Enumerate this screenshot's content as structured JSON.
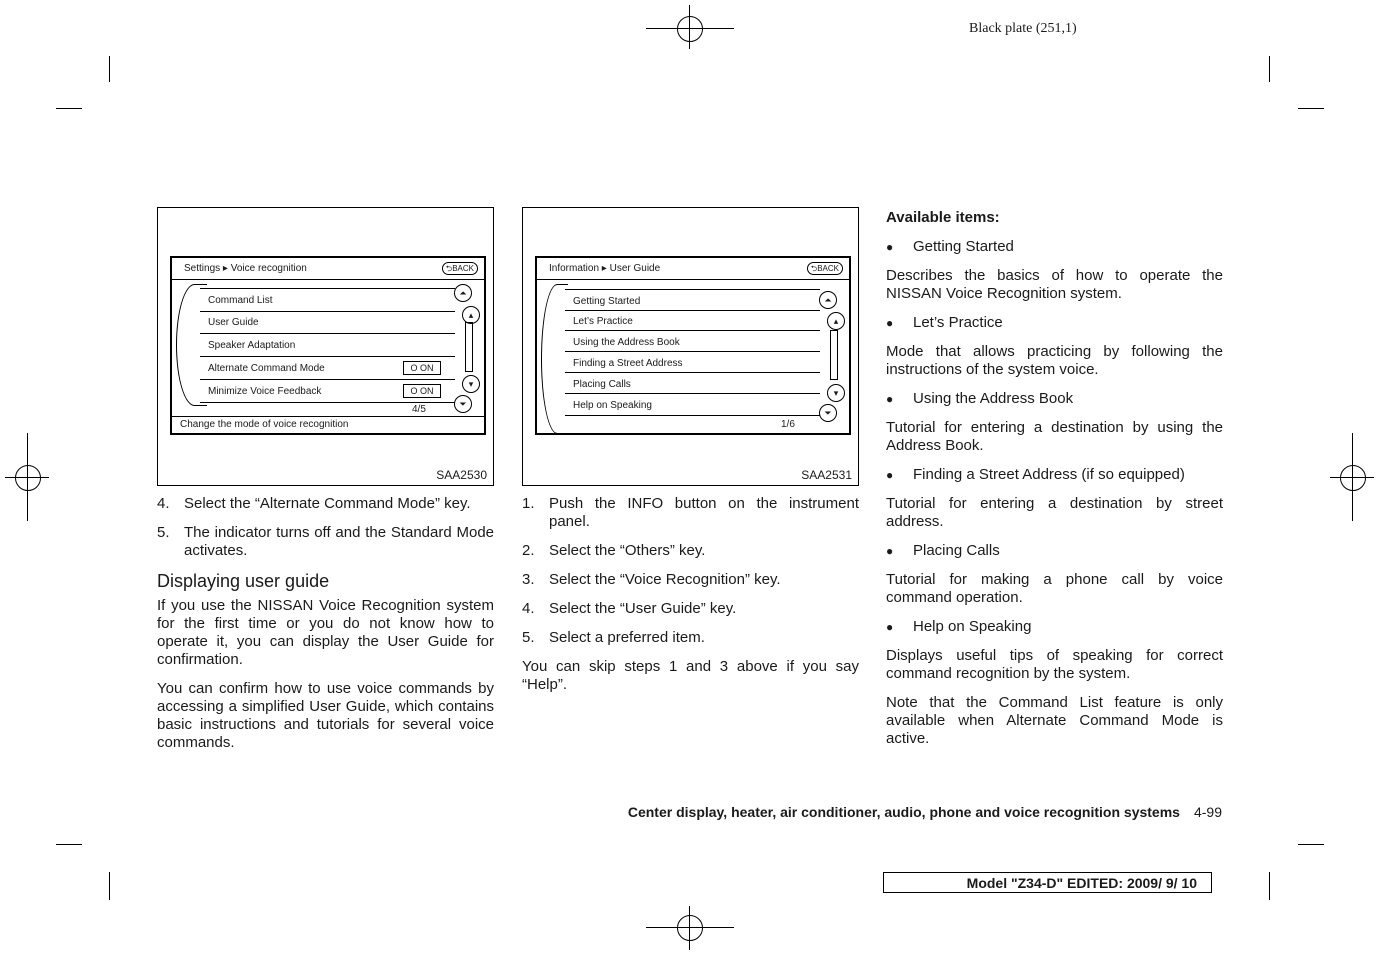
{
  "header": {
    "plate": "Black plate (251,1)"
  },
  "figure1": {
    "code": "SAA2530",
    "breadcrumb": "Settings ▸ Voice recognition",
    "back": "BACK",
    "items": [
      "Command List",
      "User Guide",
      "Speaker Adaptation",
      "Alternate Command Mode",
      "Minimize Voice Feedback"
    ],
    "toggle": "O  ON",
    "page": "4/5",
    "status": "Change the mode of voice recognition"
  },
  "figure2": {
    "code": "SAA2531",
    "breadcrumb": "Information ▸ User Guide",
    "back": "BACK",
    "items": [
      "Getting Started",
      "Let’s Practice",
      "Using the Address Book",
      "Finding a Street Address",
      "Placing Calls",
      "Help on Speaking"
    ],
    "page": "1/6"
  },
  "left": {
    "steps": [
      {
        "n": "4.",
        "t": "Select the “Alternate Command Mode” key."
      },
      {
        "n": "5.",
        "t": "The indicator turns off and the Standard Mode activates."
      }
    ],
    "heading": "Displaying user guide",
    "paras": [
      "If you use the NISSAN Voice Recognition system for the first time or you do not know how to operate it, you can display the User Guide for confirmation.",
      "You can confirm how to use voice commands by accessing a simplified User Guide, which contains basic instructions and tutorials for several voice commands."
    ]
  },
  "middle": {
    "steps": [
      {
        "n": "1.",
        "t": "Push the INFO button on the instrument panel."
      },
      {
        "n": "2.",
        "t": "Select the “Others” key."
      },
      {
        "n": "3.",
        "t": "Select the “Voice Recognition” key."
      },
      {
        "n": "4.",
        "t": "Select the “User Guide” key."
      },
      {
        "n": "5.",
        "t": "Select a preferred item."
      }
    ],
    "para": "You can skip steps 1 and 3 above if you say “Help”."
  },
  "right": {
    "heading": "Available items:",
    "items": [
      {
        "title": "Getting Started",
        "desc": "Describes the basics of how to operate the NISSAN Voice Recognition system."
      },
      {
        "title": "Let’s Practice",
        "desc": "Mode that allows practicing by following the instructions of the system voice."
      },
      {
        "title": "Using the Address Book",
        "desc": "Tutorial for entering a destination by using the Address Book."
      },
      {
        "title": "Finding a Street Address (if so equipped)",
        "desc": "Tutorial for entering a destination by street address."
      },
      {
        "title": "Placing Calls",
        "desc": "Tutorial for making a phone call by voice command operation."
      },
      {
        "title": "Help on Speaking",
        "desc": "Displays useful tips of speaking for correct command recognition by the system."
      }
    ],
    "note": "Note that the Command List feature is only available when Alternate Command Mode is active."
  },
  "footer": {
    "section": "Center display, heater, air conditioner, audio, phone and voice recognition systems",
    "page": "4-99",
    "model": "Model \"Z34-D\"  EDITED:  2009/ 9/ 10"
  }
}
